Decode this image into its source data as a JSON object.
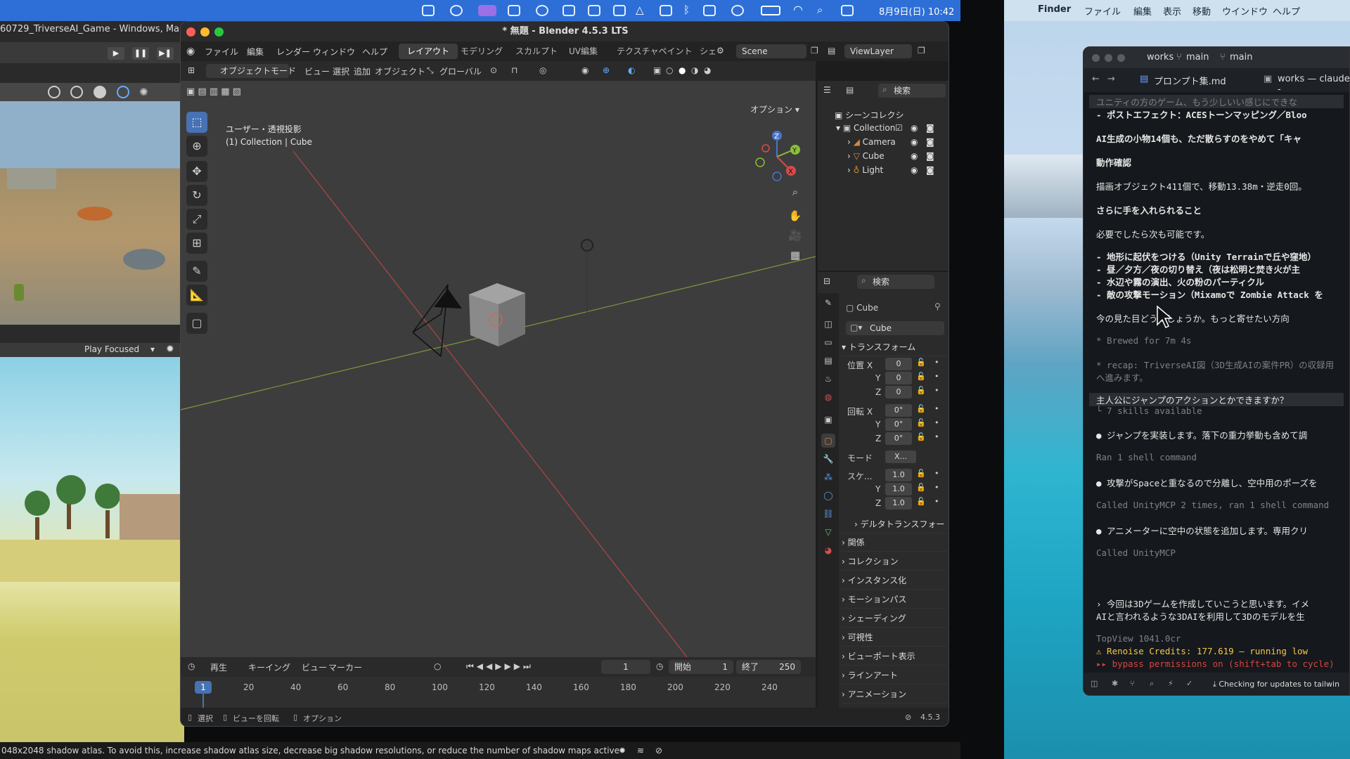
{
  "menubar": {
    "clock": "8月9日(日) 10:42"
  },
  "game": {
    "title": "60729_TriverseAI_Game - Windows, Ma",
    "play_focused": "Play Focused"
  },
  "blender": {
    "title": "* 無題 - Blender 4.5.3 LTS",
    "menus": [
      "ファイル",
      "編集",
      "レンダー",
      "ウィンドウ",
      "ヘルプ"
    ],
    "workspaces": [
      "レイアウト",
      "モデリング",
      "スカルプト",
      "UV編集",
      "テクスチャペイント",
      "シェ"
    ],
    "scene": "Scene",
    "view_layer": "ViewLayer",
    "vp_header": {
      "mode": "オブジェクトモード",
      "items": [
        "ビュー",
        "選択",
        "追加",
        "オブジェクト"
      ],
      "transform": "グローバル",
      "options": "オプション"
    },
    "viewport_info": [
      "ユーザー・透視投影",
      "(1) Collection | Cube"
    ],
    "outliner": {
      "header": "シーンコレクシ",
      "search": "検索",
      "collection": "Collection",
      "items": [
        "Camera",
        "Cube",
        "Light"
      ]
    },
    "props": {
      "search": "検索",
      "object": "Cube",
      "object_field": "Cube",
      "transform": "トランスフォーム",
      "location_label": "位置 X",
      "rotation_label": "回転 X",
      "mode_label": "モード",
      "mode_value": "X...",
      "scale_label": "スケ...",
      "axis_y": "Y",
      "axis_z": "Z",
      "loc": [
        "0",
        "0",
        "0"
      ],
      "rot": [
        "0°",
        "0°",
        "0°"
      ],
      "scale": [
        "1.0",
        "1.0",
        "1.0"
      ],
      "delta": "デルタトランスフォー",
      "sections": [
        "関係",
        "コレクション",
        "インスタンス化",
        "モーションパス",
        "シェーディング",
        "可視性",
        "ビューポート表示",
        "ラインアート",
        "アニメーション"
      ]
    },
    "timeline": {
      "menus": [
        "再生",
        "キーイング",
        "ビュー",
        "マーカー"
      ],
      "frame": "1",
      "start_label": "開始",
      "start": "1",
      "end_label": "終了",
      "end": "250",
      "ticks": [
        "1",
        "20",
        "40",
        "60",
        "80",
        "100",
        "120",
        "140",
        "160",
        "180",
        "200",
        "220",
        "240"
      ]
    },
    "status": {
      "select": "選択",
      "rotate": "ビューを回転",
      "options": "オプション",
      "version": "4.5.3"
    }
  },
  "statusbar": "048x2048 shadow atlas. To avoid this, increase shadow atlas size, decrease big shadow resolutions, or reduce the number of shadow maps active",
  "finder": {
    "app": "Finder",
    "menus": [
      "ファイル",
      "編集",
      "表示",
      "移動",
      "ウインドウ",
      "ヘルプ"
    ]
  },
  "terminal": {
    "title": "works",
    "branch1": "main",
    "branch2": "main",
    "tab1": "プロンプト集.md",
    "tab2": "works — claude -",
    "lines": [
      {
        "t": "ユニティの方のゲーム、もう少しいい感じにできな",
        "c": "dim"
      },
      {
        "t": "- ポストエフェクト：ACESトーンマッピング／Bloo",
        "c": ""
      },
      {
        "t": "AI生成の小物14個も、ただ散らすのをやめて「キャ",
        "c": ""
      },
      {
        "t": "動作確認",
        "c": ""
      },
      {
        "t": "描画オブジェクト411個で、移動13.38m・逆走0回。",
        "c": ""
      },
      {
        "t": "さらに手を入れられること",
        "c": ""
      },
      {
        "t": "必要でしたら次も可能です。",
        "c": ""
      },
      {
        "t": "- 地形に起伏をつける（Unity Terrainで丘や窪地）",
        "c": ""
      },
      {
        "t": "- 昼／夕方／夜の切り替え（夜は松明と焚き火が主",
        "c": ""
      },
      {
        "t": "- 水辺や霧の演出、火の粉のパーティクル",
        "c": ""
      },
      {
        "t": "- 敵の攻撃モーション（Mixamoで Zombie Attack を",
        "c": ""
      },
      {
        "t": "今の見た目どうでしょうか。もっと寄せたい方向",
        "c": ""
      },
      {
        "t": "* Brewed for 7m 4s",
        "c": "dim"
      },
      {
        "t": "* recap: TriverseAI図（3D生成AIの案件PR）の収録用",
        "c": "dim"
      },
      {
        "t": "へ進みます。",
        "c": "dim"
      },
      {
        "t": "主人公にジャンプのアクションとかできますか？",
        "c": ""
      },
      {
        "t": "└ 7 skills available",
        "c": "dim"
      },
      {
        "t": "● ジャンプを実装します。落下の重力挙動も含めて調",
        "c": ""
      },
      {
        "t": "Ran 1 shell command",
        "c": "dim"
      },
      {
        "t": "● 攻撃がSpaceと重なるので分離し、空中用のポーズを",
        "c": ""
      },
      {
        "t": "Called UnityMCP 2 times, ran 1 shell command",
        "c": "dim"
      },
      {
        "t": "● アニメーターに空中の状態を追加します。専用クリ",
        "c": ""
      },
      {
        "t": "Called UnityMCP",
        "c": "dim"
      },
      {
        "t": "› 今回は3Dゲームを作成していこうと思います。イメ",
        "c": ""
      },
      {
        "t": "AIと言われるような3DAIを利用して3Dのモデルを生",
        "c": ""
      },
      {
        "t": "TopView 1041.0cr",
        "c": "dim"
      },
      {
        "t": "⚠ Renoise Credits: 177.619 — running low",
        "c": "warn"
      },
      {
        "t": "▸▸ bypass permissions on (shift+tab to cycle)",
        "c": "dim"
      }
    ],
    "footer": "Checking for updates to tailwin"
  }
}
